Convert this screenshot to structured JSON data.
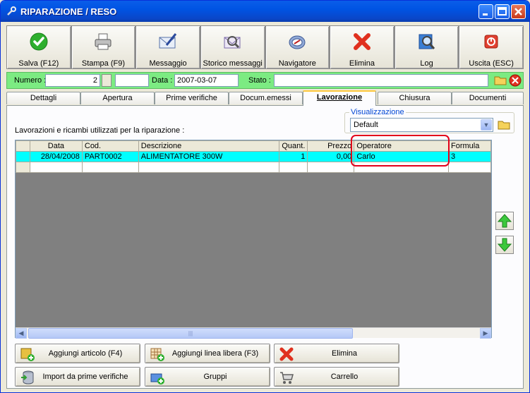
{
  "window": {
    "title": "RIPARAZIONE / RESO",
    "minimize_icon": "minimize-icon",
    "maximize_icon": "maximize-icon",
    "close_icon": "close-icon"
  },
  "toolbar": [
    {
      "label": "Salva (F12)",
      "icon": "check-icon"
    },
    {
      "label": "Stampa (F9)",
      "icon": "printer-icon"
    },
    {
      "label": "Messaggio",
      "icon": "envelope-pen-icon"
    },
    {
      "label": "Storico messaggi",
      "icon": "envelope-search-icon"
    },
    {
      "label": "Navigatore",
      "icon": "compass-icon"
    },
    {
      "label": "Elimina",
      "icon": "delete-x-icon"
    },
    {
      "label": "Log",
      "icon": "log-search-icon"
    },
    {
      "label": "Uscita (ESC)",
      "icon": "power-icon"
    }
  ],
  "header": {
    "numero_label": "Numero :",
    "numero_value": "2",
    "numero_extra": "",
    "data_label": "Data :",
    "data_value": "2007-03-07",
    "stato_label": "Stato :",
    "stato_value": ""
  },
  "tabs": [
    {
      "label": "Dettagli",
      "active": false
    },
    {
      "label": "Apertura",
      "active": false
    },
    {
      "label": "Prime verifiche",
      "active": false
    },
    {
      "label": "Docum.emessi",
      "active": false
    },
    {
      "label": "Lavorazione",
      "active": true
    },
    {
      "label": "Chiusura",
      "active": false
    },
    {
      "label": "Documenti",
      "active": false
    }
  ],
  "lavorazione": {
    "description": "Lavorazioni e ricambi utilizzati per la riparazione :",
    "visualizzazione_label": "Visualizzazione",
    "visualizzazione_value": "Default",
    "table": {
      "columns": [
        "Data",
        "Cod.",
        "Descrizione",
        "Quant.",
        "Prezzo",
        "Operatore",
        "Formula"
      ],
      "rows": [
        [
          "28/04/2008",
          "PART0002",
          "ALIMENTATORE 300W",
          "1",
          "0,00",
          "Carlo",
          "3"
        ]
      ]
    }
  },
  "buttons": {
    "aggiungi_articolo": "Aggiungi articolo (F4)",
    "aggiungi_linea": "Aggiungi linea libera (F3)",
    "elimina": "Elimina",
    "import_prime": "Import da prime verifiche",
    "gruppi": "Gruppi",
    "carrello": "Carrello"
  },
  "colors": {
    "title_bar": "#0054E3",
    "header_bar": "#7CEB82",
    "selected_row": "#00FFFF",
    "highlight": "#E2001A"
  }
}
